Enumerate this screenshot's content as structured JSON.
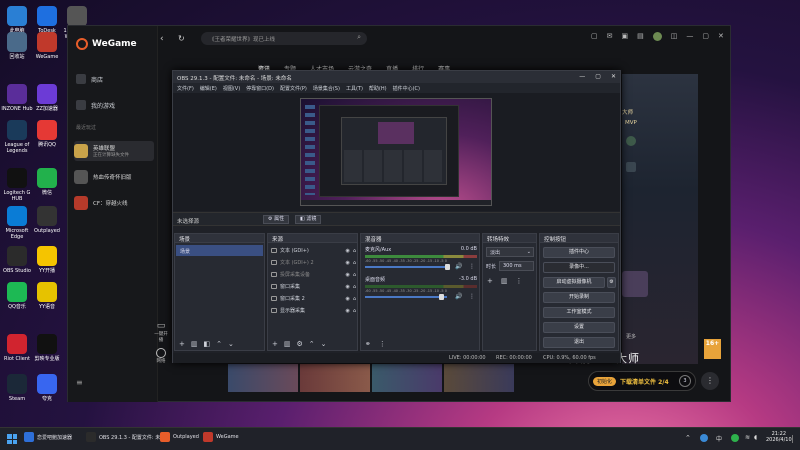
{
  "desktop": {
    "icons": [
      {
        "label": "此电脑",
        "color": "#2a7fd4"
      },
      {
        "label": "ToDesk",
        "color": "#1e6fe0"
      },
      {
        "label": "1280x800-Win10.lnk",
        "color": "#555"
      },
      {
        "label": "回收站",
        "color": "#4a6a8a"
      },
      {
        "label": "WeGame",
        "color": "#c0392b"
      },
      {
        "label": "INZONE Hub",
        "color": "#5a2d9a"
      },
      {
        "label": "ZZ加速器",
        "color": "#6c3bd6"
      },
      {
        "label": "League of Legends",
        "color": "#1a3a5a"
      },
      {
        "label": "腾讯QQ",
        "color": "#e53935"
      },
      {
        "label": "Logitech G HUB",
        "color": "#111"
      },
      {
        "label": "微信",
        "color": "#22b14c"
      },
      {
        "label": "Microsoft Edge",
        "color": "#0a7cd6"
      },
      {
        "label": "Outplayed",
        "color": "#333"
      },
      {
        "label": "OBS Studio",
        "color": "#2b2b2b"
      },
      {
        "label": "YY开播",
        "color": "#f5c400"
      },
      {
        "label": "QQ音乐",
        "color": "#1db954"
      },
      {
        "label": "YY语音",
        "color": "#e6c200"
      },
      {
        "label": "Riot Client",
        "color": "#d1242f"
      },
      {
        "label": "剪映专业版",
        "color": "#111"
      },
      {
        "label": "Steam",
        "color": "#1b2838"
      },
      {
        "label": "夸克",
        "color": "#3866f0"
      }
    ]
  },
  "wegame": {
    "logo": "WeGame",
    "search_placeholder": "《王者荣耀世界》现已上线",
    "nav": [
      {
        "label": "商店"
      },
      {
        "label": "我的游戏"
      }
    ],
    "recent_label": "最近玩过",
    "games": [
      {
        "name": "英雄联盟",
        "sub": "正在计算缺失文件",
        "color": "#c9a34a"
      },
      {
        "name": "热血传奇怀旧版",
        "sub": "",
        "color": "#555"
      },
      {
        "name": "CF：穿越火线",
        "sub": "",
        "color": "#b53a2a"
      }
    ],
    "tabs": [
      "资讯",
      "专题",
      "人才市场",
      "云游之奇",
      "直播",
      "排行",
      "赛事"
    ],
    "right_labels": [
      "大师",
      "MVP",
      "更多"
    ],
    "rating": "16+",
    "side_bottom": [
      "一键开播",
      "网络"
    ],
    "watermark": "目前一区大师",
    "download": {
      "badge": "初始化",
      "text": "下载清单文件 2/4",
      "count": "3"
    }
  },
  "obs": {
    "title": "OBS 29.1.3 - 配置文件: 未命名 - 场景: 未命名",
    "menu": [
      "文件(F)",
      "编辑(E)",
      "视图(V)",
      "停靠窗口(D)",
      "配置文件(P)",
      "场景集合(S)",
      "工具(T)",
      "帮助(H)",
      "插件中心(C)"
    ],
    "no_source": "未选择源",
    "props_btn": "属性",
    "filter_btn": "滤镜",
    "docks": {
      "scenes": "场景",
      "sources": "来源",
      "mixer": "混音器",
      "transitions": "转场特效",
      "controls": "控制按钮"
    },
    "scene_items": [
      "场景"
    ],
    "sources": [
      "文本 (GDI+)",
      "文本 (GDI+) 2",
      "投屏采集设备",
      "窗口采集",
      "窗口采集 2",
      "显示器采集"
    ],
    "mixer": [
      {
        "name": "麦克风/Aux",
        "db": "0.0 dB"
      },
      {
        "name": "桌面音频",
        "db": "-3.0 dB"
      }
    ],
    "meter_ticks": "-60 -55 -50 -45 -40 -35 -30 -25 -20 -15 -10 -5 0",
    "transition": {
      "type": "淡出",
      "duration_label": "时长",
      "duration": "300 ms"
    },
    "controls": [
      "插件中心",
      "录像中...",
      "启动虚拟摄像机",
      "开始录制",
      "工作室模式",
      "设置",
      "退出"
    ],
    "status": {
      "live": "LIVE: 00:00:00",
      "rec": "REC: 00:00:00",
      "cpu": "CPU: 0.9%, 60.00 fps"
    }
  },
  "taskbar": {
    "items": [
      {
        "label": "恋爱吧鲍加速器",
        "color": "#2e6fd8"
      },
      {
        "label": "OBS 29.1.3 - 配置文件: 未...",
        "color": "#2b2b2b"
      },
      {
        "label": "Outplayed",
        "color": "#e85d2a"
      },
      {
        "label": "WeGame",
        "color": "#c0392b"
      }
    ],
    "tray": [
      "中"
    ],
    "time": "21:22",
    "date": "2026/4/10"
  }
}
